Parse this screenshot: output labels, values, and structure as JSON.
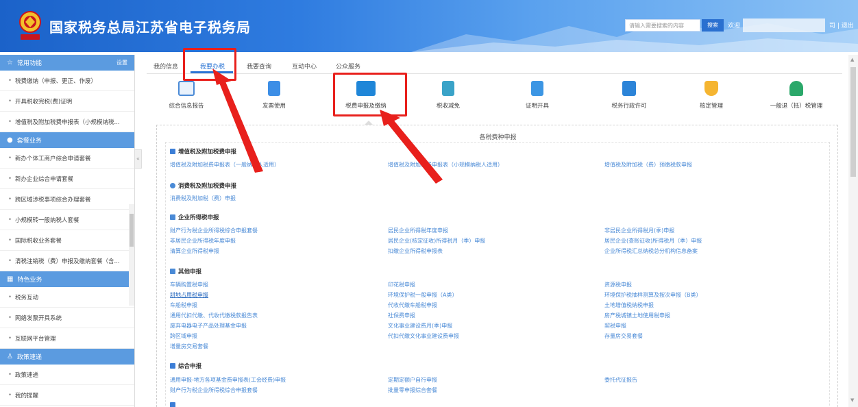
{
  "header": {
    "title": "国家税务总局江苏省电子税务局",
    "search_placeholder": "请输入需要搜索的内容",
    "search_button": "搜索",
    "welcome": "欢迎",
    "user_links": "司 | 退出"
  },
  "sidebar": {
    "sections": [
      {
        "title": "常用功能",
        "setting": "设置",
        "icon": "star-icon",
        "items": [
          "税费缴纳（申报、更正、作废）",
          "开具税收完税(费)证明",
          "增值税及附加税费申报表（小规模纳税..."
        ]
      },
      {
        "title": "套餐业务",
        "icon": "circle-icon",
        "items": [
          "新办个体工商户综合申请套餐",
          "新办企业综合申请套餐",
          "跨区域涉税事项综合办理套餐",
          "小规模转一般纳税人套餐",
          "国际税收业务套餐",
          "清税注销税（费）申报及缴纳套餐（含..."
        ]
      },
      {
        "title": "特色业务",
        "icon": "grid-icon",
        "items": [
          "税务互动",
          "网络发票开具系统",
          "互联网平台管理"
        ]
      },
      {
        "title": "政策速递",
        "icon": "person-icon",
        "items": [
          "政策速递",
          "我的提醒"
        ]
      }
    ]
  },
  "tabs": [
    "我的信息",
    "我要办税",
    "我要查询",
    "互动中心",
    "公众服务"
  ],
  "active_tab": "我要办税",
  "functions": [
    {
      "label": "综合信息报告",
      "icon": "monitor-chart-icon"
    },
    {
      "label": "发票使用",
      "icon": "document-icon"
    },
    {
      "label": "税费申报及缴纳",
      "icon": "monitor-icon"
    },
    {
      "label": "税收减免",
      "icon": "bar-chart-icon"
    },
    {
      "label": "证明开具",
      "icon": "certificate-icon"
    },
    {
      "label": "税务行政许可",
      "icon": "id-card-icon"
    },
    {
      "label": "核定管理",
      "icon": "shield-icon"
    },
    {
      "label": "一般退（抵）税管理",
      "icon": "org-chart-icon"
    }
  ],
  "panel": {
    "title": "各税费种申报",
    "sections": [
      {
        "title": "增值税及附加税费申报",
        "icon": "square-icon",
        "links": [
          [
            "增值税及附加税费申报表（一般纳税人适用）",
            "增值税及附加税费申报表（小规模纳税人适用）",
            "增值税及附加税（费）预缴税款申报"
          ]
        ]
      },
      {
        "title": "消费税及附加税费申报",
        "icon": "person-icon",
        "links": [
          [
            "消费税及附加税（费）申报"
          ]
        ]
      },
      {
        "title": "企业所得税申报",
        "icon": "chart-icon",
        "links": [
          [
            "财产行为税企业所得税综合申报套餐",
            "居民企业所得税年度申报",
            "非居民企业所得税月(季)申报"
          ],
          [
            "非居民企业所得税年度申报",
            "居民企业(核定征收)所得税月（季）申报",
            "居民企业(查账征收)所得税月（季）申报"
          ],
          [
            "清算企业所得税申报",
            "扣缴企业所得税申报表",
            "企业所得税汇总纳税总分机构信息备案"
          ]
        ]
      },
      {
        "title": "其他申报",
        "icon": "grid-icon",
        "links": [
          [
            "车辆购置税申报",
            "印花税申报",
            "资源税申报"
          ],
          [
            "耕地占用税申报",
            "环境保护税一般申报（A类）",
            "环境保护税抽样测算及按次申报（B类）"
          ],
          [
            "车船税申报",
            "代收代缴车船税申报",
            "土地增值税纳税申报"
          ],
          [
            "通用代扣代缴、代收代缴税款报告表",
            "社保费申报",
            "房产税城镇土地使用税申报"
          ],
          [
            "废弃电器电子产品处理基金申报",
            "文化事业建设费月(季)申报",
            "契税申报"
          ],
          [
            "跨区域申报",
            "代扣代缴文化事业建设费申报",
            "存量房交易套餐"
          ],
          [
            "增量房交易套餐"
          ]
        ]
      },
      {
        "title": "综合申报",
        "icon": "square-icon",
        "links": [
          [
            "通用申报-地方各项基金费申报表(工会经费)申报",
            "定期定额户自行申报",
            "委托代征报告"
          ],
          [
            "财产行为税企业所得税综合申报套餐",
            "批量零申报综合套餐"
          ]
        ]
      }
    ]
  },
  "colors": {
    "header_blue": "#1b62c9",
    "accent": "#2a74d4",
    "link": "#4a8ad6",
    "callout_red": "#e8201c",
    "sidebar_head": "#5b9be0"
  }
}
